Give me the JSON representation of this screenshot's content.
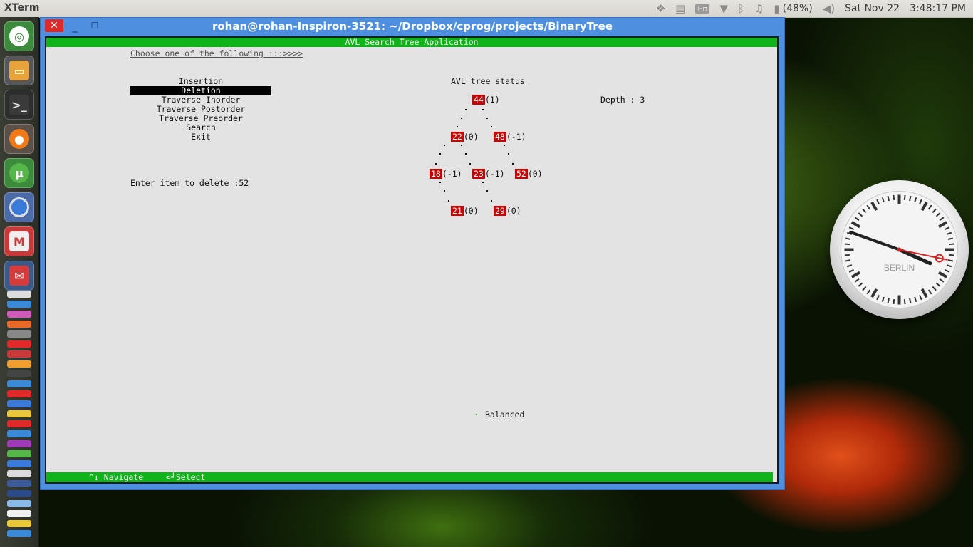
{
  "top_panel": {
    "app_name": "XTerm",
    "keyboard_layout": "En",
    "battery": "(48%)",
    "date": "Sat Nov 22",
    "time": "3:48:17 PM"
  },
  "window": {
    "title": "rohan@rohan-Inspiron-3521: ~/Dropbox/cprog/projects/BinaryTree",
    "close_glyph": "✕",
    "min_glyph": "_",
    "max_glyph": "☐"
  },
  "terminal": {
    "header": "AVL Search Tree Application",
    "prompt": "Choose one of the following :::>>>>",
    "menu": [
      "Insertion",
      "Deletion",
      "Traverse Inorder",
      "Traverse Postorder",
      "Traverse Preorder",
      "Search",
      "Exit"
    ],
    "selected_index": 1,
    "input_line": "Enter item to delete :52",
    "tree_title": "AVL tree status",
    "depth": "Depth : 3",
    "nodes": [
      {
        "value": "44",
        "balance": "(1)"
      },
      {
        "value": "22",
        "balance": "(0)"
      },
      {
        "value": "48",
        "balance": "(-1)"
      },
      {
        "value": "18",
        "balance": "(-1)"
      },
      {
        "value": "23",
        "balance": "(-1)"
      },
      {
        "value": "52",
        "balance": "(0)"
      },
      {
        "value": "21",
        "balance": "(0)"
      },
      {
        "value": "29",
        "balance": "(0)"
      }
    ],
    "status": "Balanced",
    "footer_navigate": "^↓ Navigate",
    "footer_select": "<┘Select"
  },
  "clock": {
    "city": "BERLIN",
    "hour": 3,
    "minute": 48,
    "second": 17
  },
  "colors": {
    "terminal_green": "#11b31b",
    "node_red": "#c80000",
    "titlebar_blue": "#4e8fe0"
  }
}
